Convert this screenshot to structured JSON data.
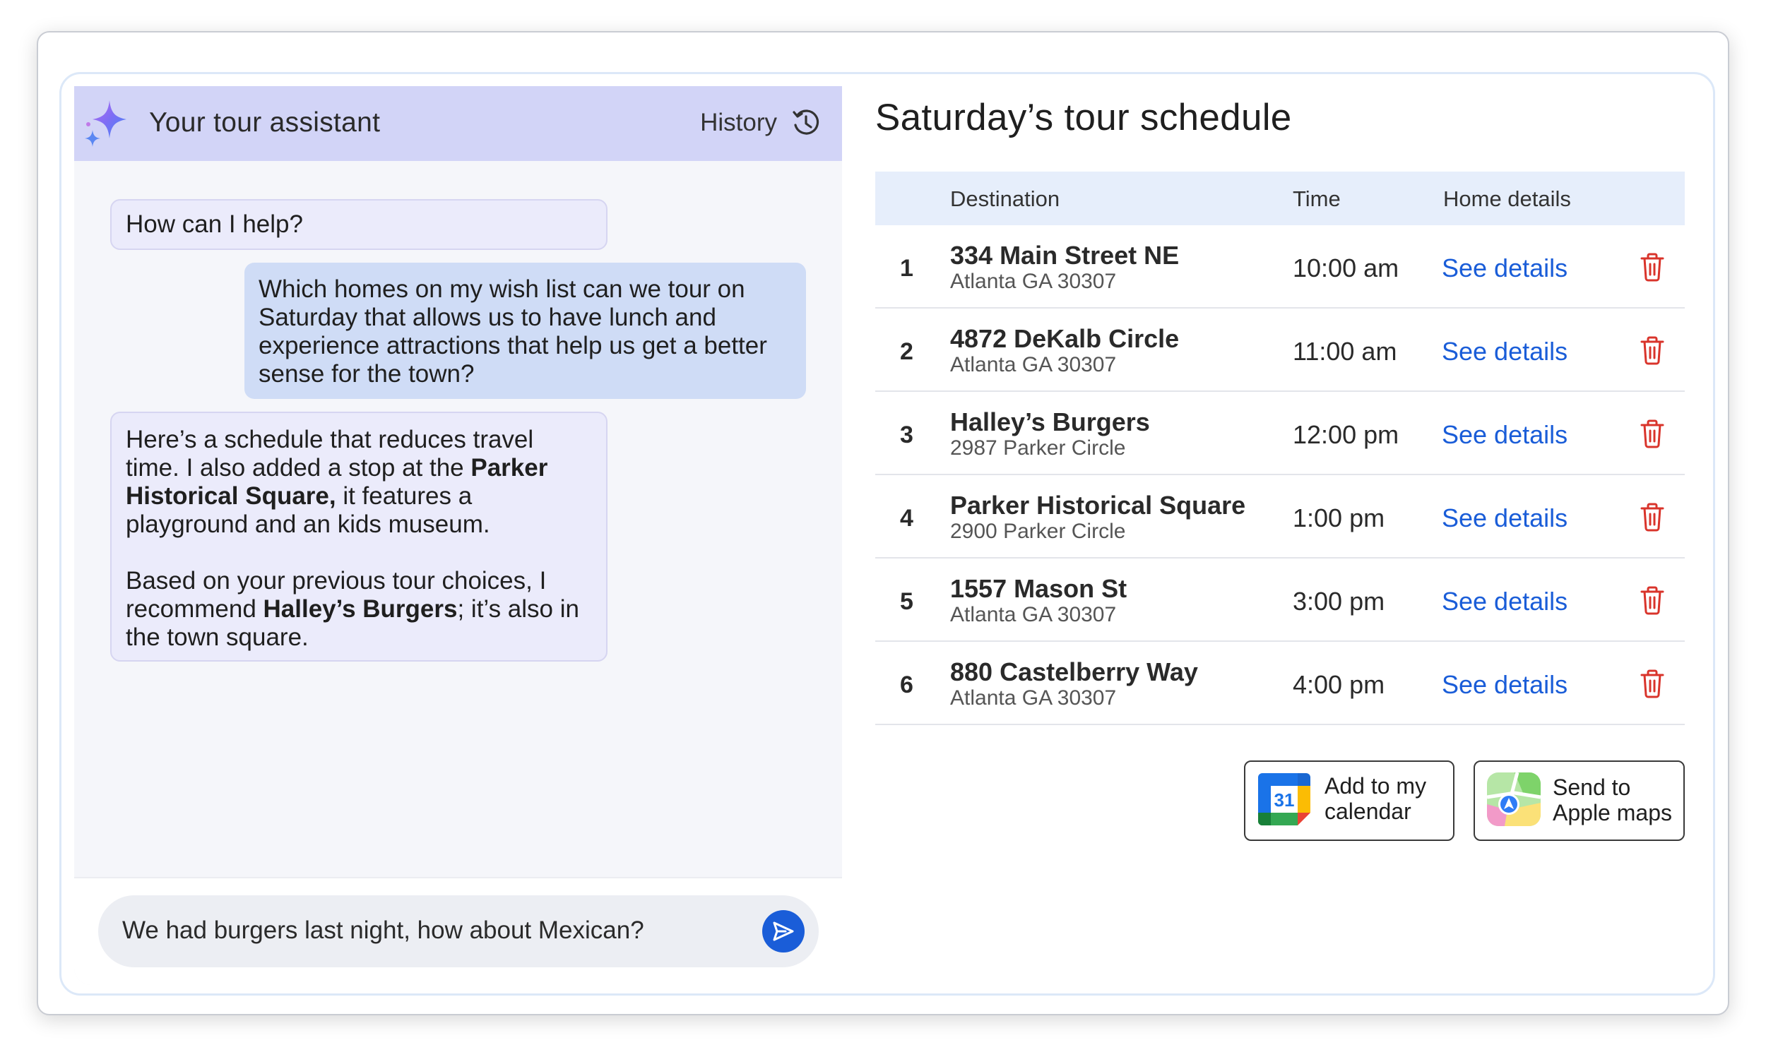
{
  "chat": {
    "title": "Your tour assistant",
    "history_label": "History",
    "messages": [
      {
        "role": "assistant",
        "text": "How can I help?"
      },
      {
        "role": "user",
        "text": "Which homes on my wish list can we tour on Saturday that allows us to have lunch and experience attractions that help us get a better sense for the town?"
      },
      {
        "role": "assistant",
        "p1_a": "Here’s a schedule that reduces travel time. I also added a stop at the ",
        "p1_bold": "Parker Historical Square,",
        "p1_b": " it features a playground and an kids museum.",
        "p2_a": "Based on your previous tour choices, I recommend ",
        "p2_bold": "Halley’s Burgers",
        "p2_b": "; it’s also in the town square."
      }
    ],
    "input_value": "We had burgers last night, how about Mexican?"
  },
  "schedule": {
    "title": "Saturday’s tour schedule",
    "columns": {
      "destination": "Destination",
      "time": "Time",
      "home_details": "Home details"
    },
    "rows": [
      {
        "num": "1",
        "name": "334 Main Street NE",
        "address": "Atlanta GA 30307",
        "time": "10:00 am",
        "link": "See details"
      },
      {
        "num": "2",
        "name": "4872 DeKalb Circle",
        "address": "Atlanta GA 30307",
        "time": "11:00 am",
        "link": "See details"
      },
      {
        "num": "3",
        "name": "Halley’s Burgers",
        "address": "2987 Parker Circle",
        "time": "12:00 pm",
        "link": "See details"
      },
      {
        "num": "4",
        "name": "Parker Historical Square",
        "address": "2900 Parker Circle",
        "time": "1:00 pm",
        "link": "See details"
      },
      {
        "num": "5",
        "name": "1557 Mason St",
        "address": "Atlanta GA 30307",
        "time": "3:00 pm",
        "link": "See details"
      },
      {
        "num": "6",
        "name": "880 Castelberry Way",
        "address": "Atlanta GA 30307",
        "time": "4:00 pm",
        "link": "See details"
      }
    ],
    "calendar_button": {
      "label_line1": "Add to my",
      "label_line2": "calendar",
      "icon_text": "31"
    },
    "maps_button": {
      "label_line1": "Send to",
      "label_line2": "Apple maps"
    }
  },
  "colors": {
    "header_bg": "#d2d4f7",
    "user_bubble": "#cfdcf6",
    "assistant_bubble": "#ebebfb",
    "link": "#1a5dd8",
    "trash": "#d9342b",
    "table_header": "#e6eefb"
  },
  "icons": [
    "sparkle-icon",
    "history-icon",
    "send-icon",
    "trash-icon",
    "google-calendar-icon",
    "apple-maps-icon"
  ]
}
